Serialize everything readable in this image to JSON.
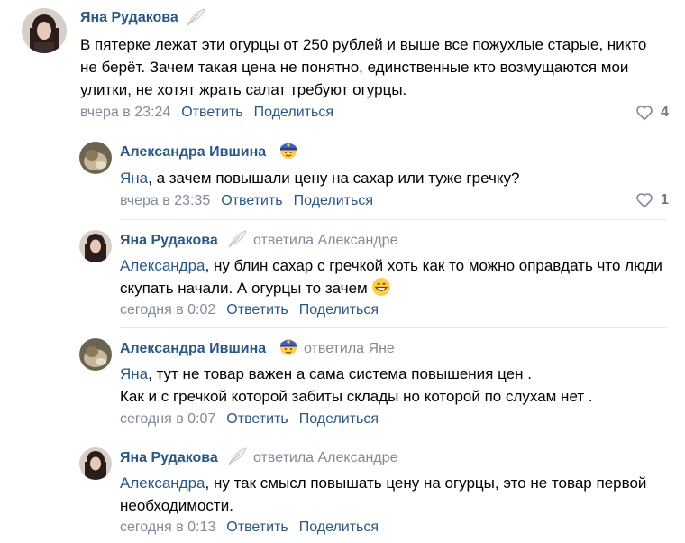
{
  "comments": [
    {
      "author": "Яна Рудакова",
      "reply_to": "",
      "address": "",
      "text": "В пятерке лежат эти огурцы от 250 рублей и выше все пожухлые старые, никто не берёт. Зачем такая цена не понятно, единственные кто возмущаются мои улитки, не хотят жрать салат требуют огурцы.",
      "time": "вчера в 23:24",
      "reply_label": "Ответить",
      "share_label": "Поделиться",
      "likes": "4"
    },
    {
      "author": "Александра Ившина",
      "reply_to": "",
      "address": "Яна",
      "text": ", а зачем повышали цену на сахар или туже гречку?",
      "time": "вчера в 23:35",
      "reply_label": "Ответить",
      "share_label": "Поделиться",
      "likes": "1"
    },
    {
      "author": "Яна Рудакова",
      "reply_to": "ответила Александре",
      "address": "Александра",
      "text": ", ну блин сахар с гречкой хоть как то можно оправдать что люди скупать начали. А огурцы то зачем",
      "time": "сегодня в 0:02",
      "reply_label": "Ответить",
      "share_label": "Поделиться",
      "likes": ""
    },
    {
      "author": "Александра Ившина",
      "reply_to": "ответила Яне",
      "address": "Яна",
      "text": ", тут не товар важен а сама система повышения цен .",
      "text2": "Как и с гречкой которой забиты склады но которой по слухам нет .",
      "time": "сегодня в 0:07",
      "reply_label": "Ответить",
      "share_label": "Поделиться",
      "likes": ""
    },
    {
      "author": "Яна Рудакова",
      "reply_to": "ответила Александре",
      "address": "Александра",
      "text": ", ну так смысл повышать цену на огурцы, это не товар первой необходимости.",
      "time": "сегодня в 0:13",
      "reply_label": "Ответить",
      "share_label": "Поделиться",
      "likes": ""
    }
  ],
  "colors": {
    "link": "#2a5885",
    "meta": "#818c99",
    "divider": "#e7e8ec"
  }
}
